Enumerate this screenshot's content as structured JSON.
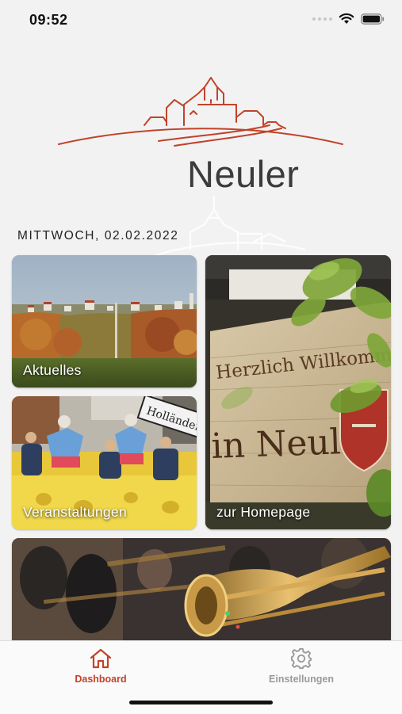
{
  "status_bar": {
    "time": "09:52",
    "icons": [
      "signal-dots-icon",
      "wifi-icon",
      "battery-icon"
    ]
  },
  "header": {
    "brand": "Neuler",
    "logo": "town-skyline-logo"
  },
  "date_line": "MITTWOCH, 02.02.2022",
  "tiles": [
    {
      "label": "Aktuelles",
      "image": "village-landscape-photo"
    },
    {
      "label": "zur Homepage",
      "image": "welcome-sign-photo",
      "sign_text": [
        "Herzlich Willkommen",
        "in Neuler"
      ]
    },
    {
      "label": "Veranstaltungen",
      "image": "carnival-parade-photo",
      "sign_text": "Holländer"
    },
    {
      "label": "",
      "image": "brass-band-trombone-photo"
    }
  ],
  "tabbar": {
    "items": [
      {
        "label": "Dashboard",
        "icon": "home-icon",
        "active": true
      },
      {
        "label": "Einstellungen",
        "icon": "gear-icon",
        "active": false
      }
    ]
  },
  "colors": {
    "accent": "#c0432a",
    "inactive": "#9a9a9a",
    "background": "#f2f2f2"
  }
}
